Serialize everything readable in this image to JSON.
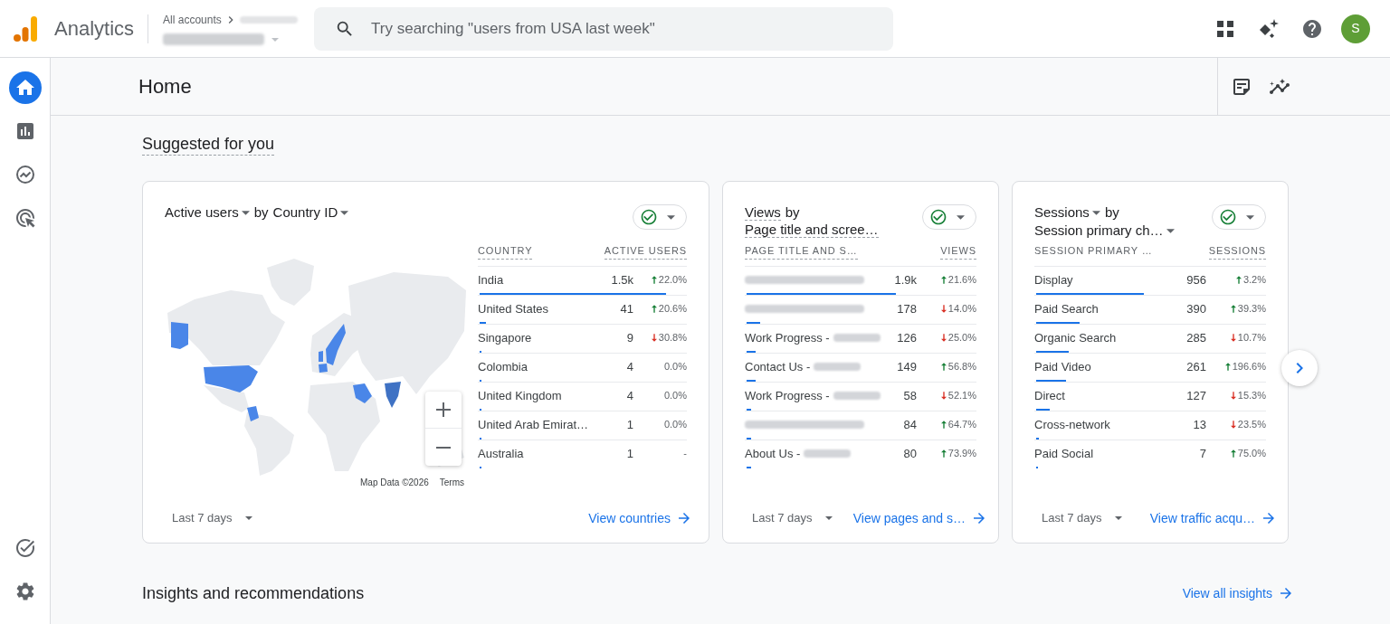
{
  "top_bar": {
    "product": "Analytics",
    "breadcrumb": "All accounts",
    "search": {
      "placeholder": "Try searching \"users from USA last week\""
    },
    "avatar": "S"
  },
  "sidebar": {
    "items": [
      {
        "selected": true
      },
      {
        "selected": false
      },
      {
        "selected": false
      },
      {
        "selected": false
      }
    ],
    "footer_items": [
      {
        "selected": false
      },
      {
        "selected": false
      }
    ]
  },
  "page": {
    "title": "Home"
  },
  "suggested": {
    "heading": "Suggested for you",
    "cards": [
      {
        "kind": "map",
        "metric": {
          "label": "Active users",
          "dropdown": true
        },
        "connector": "by",
        "dimension": {
          "label": "Country ID",
          "dropdown": true
        },
        "map": {
          "attribution": "Map Data ©2026",
          "terms": "Terms"
        },
        "columns": [
          {
            "label": "COUNTRY",
            "underlined": true
          },
          {
            "label": "ACTIVE USERS",
            "underlined": true
          }
        ],
        "rows": [
          {
            "label": "India",
            "value": "1.5k",
            "change": "22.0%",
            "increase": true,
            "level": 0.9
          },
          {
            "label": "United States",
            "value": "41",
            "change": "20.6%",
            "increase": true,
            "level": 0.03
          },
          {
            "label": "Singapore",
            "value": "9",
            "change": "30.8%",
            "increase": false,
            "level": 0.01
          },
          {
            "label": "Colombia",
            "value": "4",
            "change": "0.0%",
            "level": 0.005
          },
          {
            "label": "United Kingdom",
            "value": "4",
            "change": "0.0%",
            "level": 0.005
          },
          {
            "label": "United Arab Emirat…",
            "value": "1",
            "change": "0.0%",
            "level": 0.005
          },
          {
            "label": "Australia",
            "value": "1",
            "change": "-",
            "level": 0.005
          }
        ],
        "date_range": "Last 7 days",
        "link": "View countries"
      },
      {
        "kind": "table",
        "metric": {
          "label": "Views",
          "dropdown": false
        },
        "connector": "by",
        "dimension": {
          "label": "Page title and scree…",
          "dropdown": false
        },
        "columns": [
          {
            "label": "PAGE TITLE AND S…",
            "underlined": true
          },
          {
            "label": "VIEWS",
            "underlined": true
          }
        ],
        "rows": [
          {
            "redacted": true,
            "value": "1.9k",
            "change": "21.6%",
            "increase": true,
            "level": 0.65
          },
          {
            "redacted": true,
            "value": "178",
            "change": "14.0%",
            "increase": false,
            "level": 0.06
          },
          {
            "label": "Work Progress -",
            "redacted": true,
            "value": "126",
            "change": "25.0%",
            "increase": false,
            "level": 0.04
          },
          {
            "label": "Contact Us -",
            "redacted": true,
            "value": "149",
            "change": "56.8%",
            "increase": true,
            "level": 0.04
          },
          {
            "label": "Work Progress -",
            "redacted": true,
            "value": "58",
            "change": "52.1%",
            "increase": false,
            "level": 0.02
          },
          {
            "redacted": true,
            "value": "84",
            "change": "64.7%",
            "increase": true,
            "level": 0.02
          },
          {
            "label": "About Us -",
            "redacted": true,
            "value": "80",
            "change": "73.9%",
            "increase": true,
            "level": 0.02
          }
        ],
        "date_range": "Last 7 days",
        "link": "View pages and s…"
      },
      {
        "kind": "table",
        "metric": {
          "label": "Sessions",
          "dropdown": true
        },
        "connector": "by",
        "dimension": {
          "label": "Session primary ch…",
          "dropdown": true
        },
        "columns": [
          {
            "label": "SESSION PRIMARY …",
            "underlined": false
          },
          {
            "label": "SESSIONS",
            "underlined": true
          }
        ],
        "rows": [
          {
            "label": "Display",
            "value": "956",
            "change": "3.2%",
            "increase": true,
            "level": 0.47
          },
          {
            "label": "Paid Search",
            "value": "390",
            "change": "39.3%",
            "increase": true,
            "level": 0.19
          },
          {
            "label": "Organic Search",
            "value": "285",
            "change": "10.7%",
            "increase": false,
            "level": 0.14
          },
          {
            "label": "Paid Video",
            "value": "261",
            "change": "196.6%",
            "increase": true,
            "level": 0.13
          },
          {
            "label": "Direct",
            "value": "127",
            "change": "15.3%",
            "increase": false,
            "level": 0.06
          },
          {
            "label": "Cross-network",
            "value": "13",
            "change": "23.5%",
            "increase": false,
            "level": 0.01
          },
          {
            "label": "Paid Social",
            "value": "7",
            "change": "75.0%",
            "increase": true,
            "level": 0.005
          }
        ],
        "date_range": "Last 7 days",
        "link": "View traffic acqu…"
      }
    ]
  },
  "insights": {
    "heading": "Insights and recommendations",
    "link": "View all insights"
  }
}
